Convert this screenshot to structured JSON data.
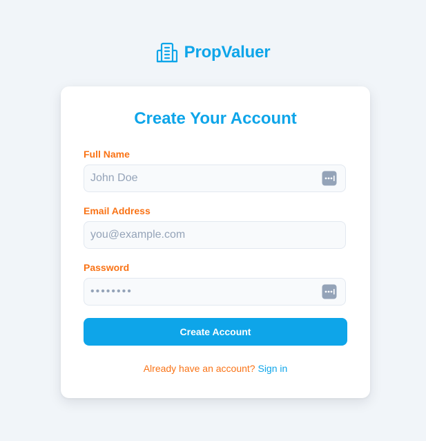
{
  "brand": {
    "name": "PropValuer",
    "icon": "building-icon",
    "color": "#0ea5e9"
  },
  "form": {
    "title": "Create Your Account",
    "fields": [
      {
        "label": "Full Name",
        "placeholder": "John Doe",
        "value": "",
        "trailing_icon": "password-manager-icon"
      },
      {
        "label": "Email Address",
        "placeholder": "you@example.com",
        "value": ""
      },
      {
        "label": "Password",
        "placeholder": "••••••••",
        "value": "",
        "trailing_icon": "password-manager-icon"
      }
    ],
    "submit_label": "Create Account",
    "footer_text": "Already have an account?",
    "signin_label": "Sign in"
  },
  "colors": {
    "accent": "#0ea5e9",
    "label": "#f97316",
    "background": "#f1f5f9"
  }
}
